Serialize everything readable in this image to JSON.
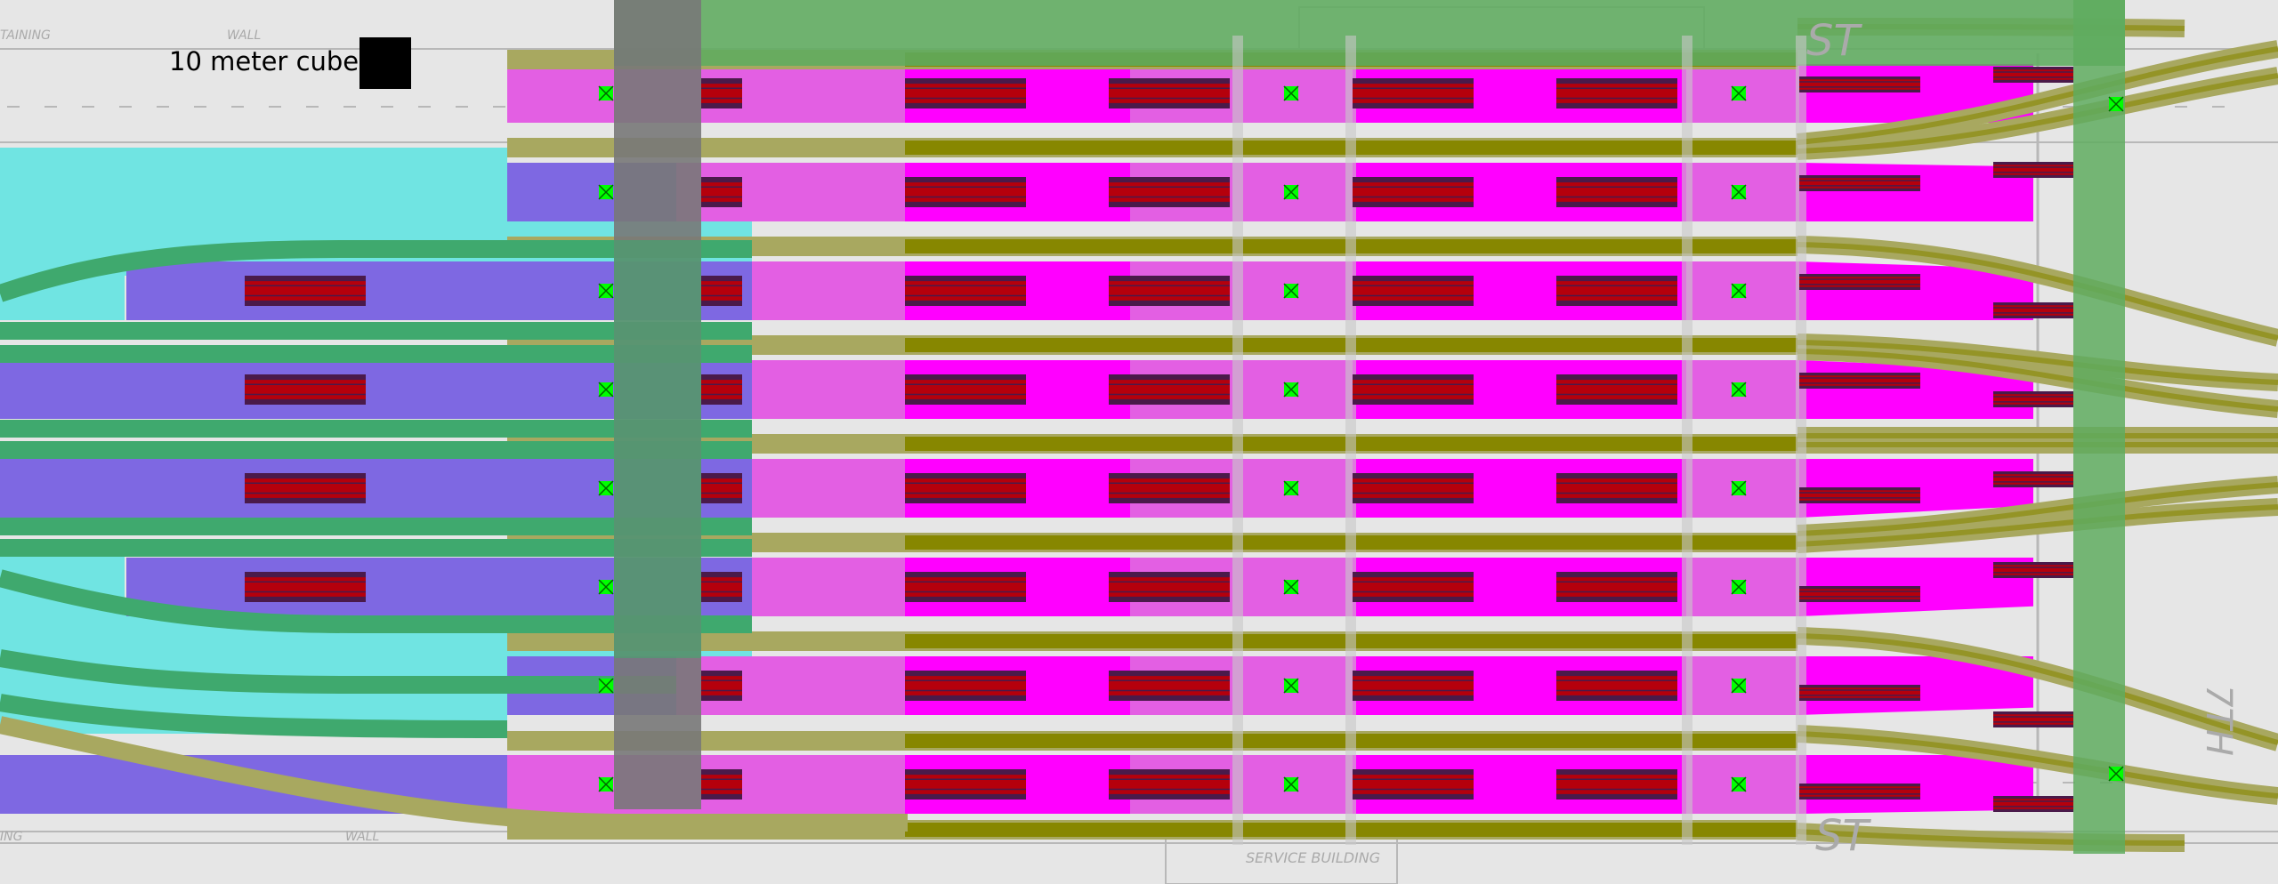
{
  "legend": {
    "scale_label": "10 meter cube"
  },
  "background_plan": {
    "labels": [
      "TAINING",
      "WALL",
      "WALL",
      "ING",
      "SERVICE BUILDING",
      "ST",
      "ST",
      "7TH"
    ]
  },
  "colors": {
    "page_background": "#e6e6e6",
    "plan_lines": "#b8b8b8",
    "mezzanine_cyan": "#70e4e2",
    "platform_violet": "#7e68e2",
    "platform_magenta": "#e35fe3",
    "platform_magenta_bright": "#ff00ff",
    "track_olive": "#a8a860",
    "track_olive_dark": "#878700",
    "track_green": "#3fa96e",
    "overlay_green": "#5fab5f",
    "stair_gray": "#787878",
    "car_red": "#b5000c",
    "car_dark": "#4a1a4a",
    "column_marker": "#00ff00",
    "scale_cube": "#000000"
  },
  "platforms": {
    "count": 8,
    "column_markers_per_platform": 3
  },
  "icons": [
    "column-marker-icon",
    "scale-cube-icon"
  ]
}
